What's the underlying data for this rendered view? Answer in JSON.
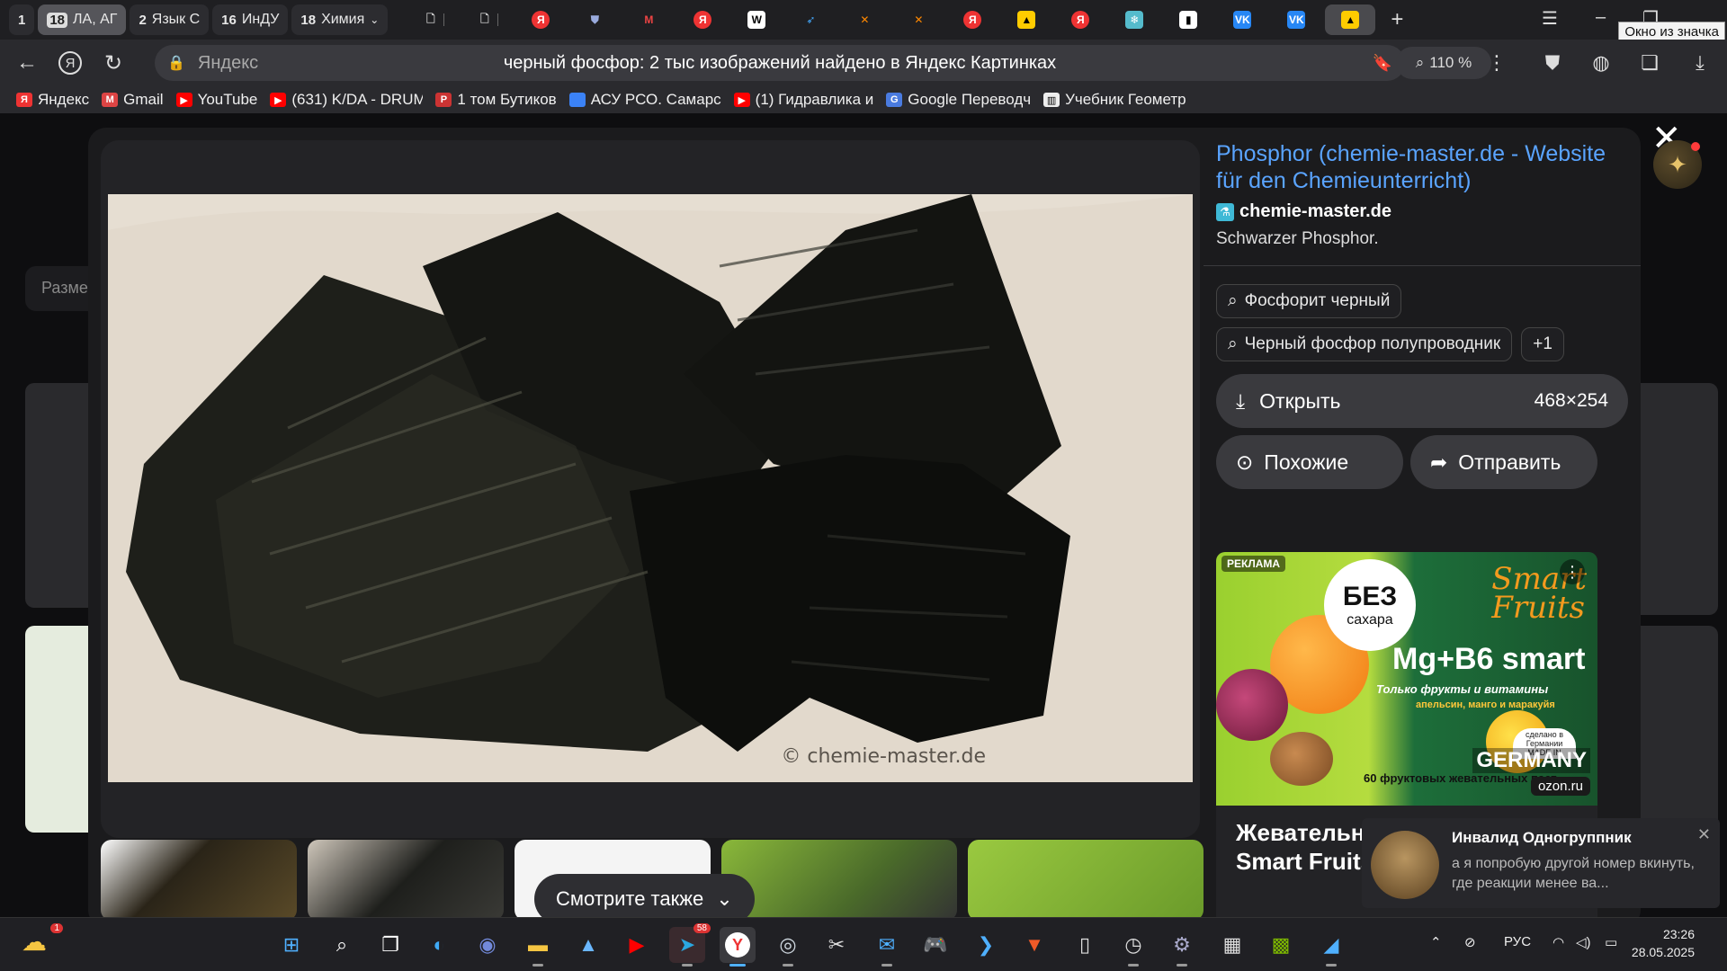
{
  "browser": {
    "tab_groups": [
      {
        "count": "1",
        "label": ""
      },
      {
        "count": "18",
        "label": "ЛА, АГ"
      },
      {
        "count": "2",
        "label": "Язык С"
      },
      {
        "count": "16",
        "label": "ИнДУ"
      },
      {
        "count": "18",
        "label": "Химия"
      }
    ],
    "tooltip": "Окно из значка",
    "address": {
      "host": "Яндекс",
      "title": "черный фосфор: 2 тыс изображений найдено в Яндекс Картинках"
    },
    "zoom": "110 %",
    "bookmarks": [
      {
        "label": "Яндекс",
        "color": "#e33"
      },
      {
        "label": "Gmail",
        "color": "#d44"
      },
      {
        "label": "YouTube",
        "color": "#f00"
      },
      {
        "label": "(631) K/DA - DRUM",
        "color": "#f00"
      },
      {
        "label": "1 том Бутиков",
        "color": "#c33"
      },
      {
        "label": "АСУ РСО. Самарс",
        "color": "#3b82f6"
      },
      {
        "label": "(1) Гидравлика и",
        "color": "#f00"
      },
      {
        "label": "Google Переводч",
        "color": "#4a7be0"
      },
      {
        "label": "Учебник Геометр",
        "color": "#eee"
      }
    ]
  },
  "background": {
    "size_filter": "Разме"
  },
  "viewer": {
    "watermark": "© chemie-master.de",
    "close": "✕"
  },
  "source": {
    "title": "Phosphor (chemie-master.de - Website für den Chemieunterricht)",
    "host": "chemie-master.de",
    "description": "Schwarzer Phosphor."
  },
  "tags": {
    "items": [
      "Фосфорит черный",
      "Черный фосфор полупроводник"
    ],
    "more": "+1"
  },
  "actions": {
    "open": "Открыть",
    "dimensions": "468×254",
    "similar": "Похожие",
    "share": "Отправить"
  },
  "ad": {
    "label": "РЕКЛАМА",
    "bez": "БЕЗ",
    "sugar": "сахара",
    "brand_line1": "Smart",
    "brand_line2": "Fruits",
    "product": "Mg+B6 smart",
    "tagline": "Только фрукты и витамины",
    "flavors": "апельсин, манго и маракуйя",
    "pieces": "60 фруктовых жевательных паст",
    "germany": "GERMANY",
    "made_in": "сделано в Германии MADE IN",
    "ozon": "ozon.ru",
    "title": "Жевательные пастилки Mg Smart Fruits, 60"
  },
  "see_also": "Смотрите также",
  "notification": {
    "sender": "Инвалид Одногруппник",
    "message": "а я попробую другой номер вкинуть, где реакции менее ва..."
  },
  "taskbar": {
    "weather_badge": "1",
    "telegram_badge": "58",
    "lang": "РУС",
    "time": "23:26",
    "date": "28.05.2025"
  }
}
